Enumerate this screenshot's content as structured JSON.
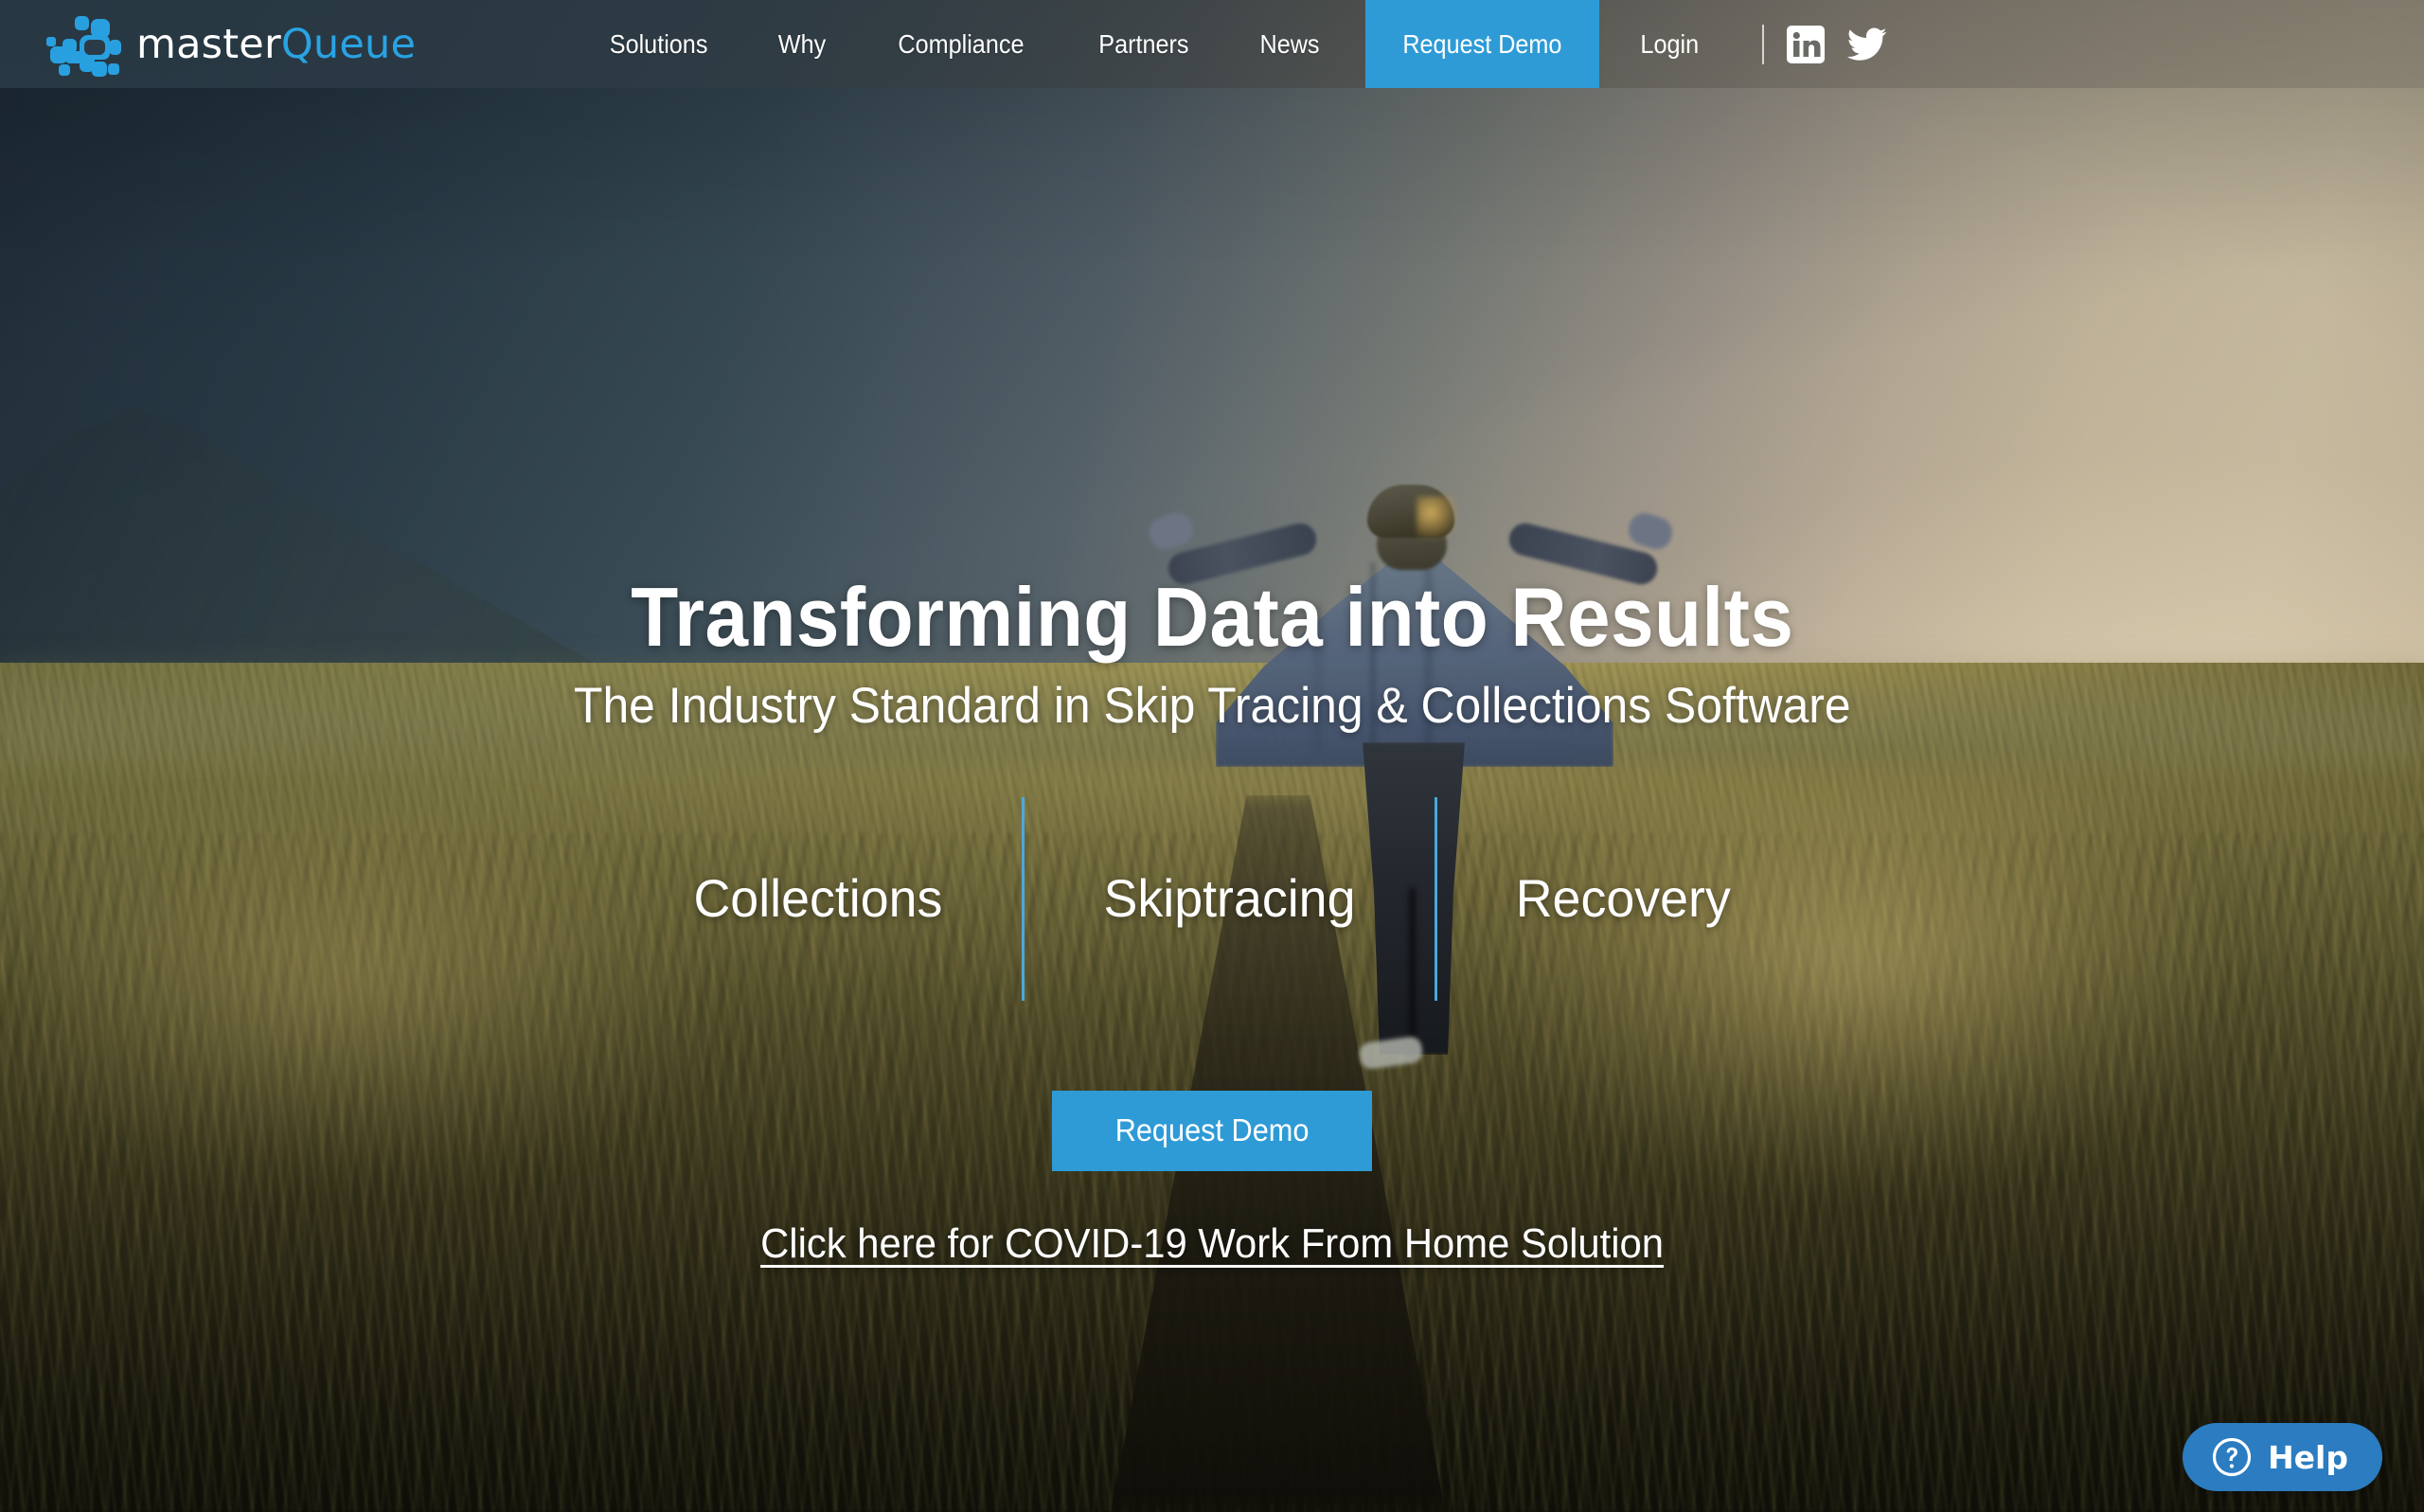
{
  "brand": {
    "name_part1": "master",
    "name_part2": "Queue",
    "logo_icon": "network-nodes-logo-icon",
    "accent_blue": "#29a3e3",
    "button_blue": "#2e9bd6",
    "divider_blue": "#4aa8dd",
    "header_dark": "#283844"
  },
  "header": {
    "nav": [
      {
        "label": "Solutions",
        "name": "nav-item-solutions"
      },
      {
        "label": "Why",
        "name": "nav-item-why"
      },
      {
        "label": "Compliance",
        "name": "nav-item-compliance"
      },
      {
        "label": "Partners",
        "name": "nav-item-partners"
      },
      {
        "label": "News",
        "name": "nav-item-news"
      }
    ],
    "cta_label": "Request Demo",
    "login_label": "Login",
    "social": [
      {
        "label": "LinkedIn",
        "icon": "linkedin-icon"
      },
      {
        "label": "Twitter",
        "icon": "twitter-icon"
      }
    ]
  },
  "hero": {
    "title": "Transforming Data into Results",
    "subtitle": "The Industry Standard in Skip Tracing & Collections Software",
    "categories": [
      {
        "label": "Collections",
        "name": "hero-category-collections"
      },
      {
        "label": "Skiptracing",
        "name": "hero-category-skiptracing"
      },
      {
        "label": "Recovery",
        "name": "hero-category-recovery"
      }
    ],
    "cta_label": "Request Demo",
    "covid_link_label": "Click here for COVID-19 Work From Home Solution",
    "background_description": "Person walking away on a path through a golden coastal grass field at sunset, mountain at left, hazy ocean horizon at right"
  },
  "help_widget": {
    "label": "Help",
    "icon": "question-circle-icon",
    "background": "#2b7cc0"
  }
}
